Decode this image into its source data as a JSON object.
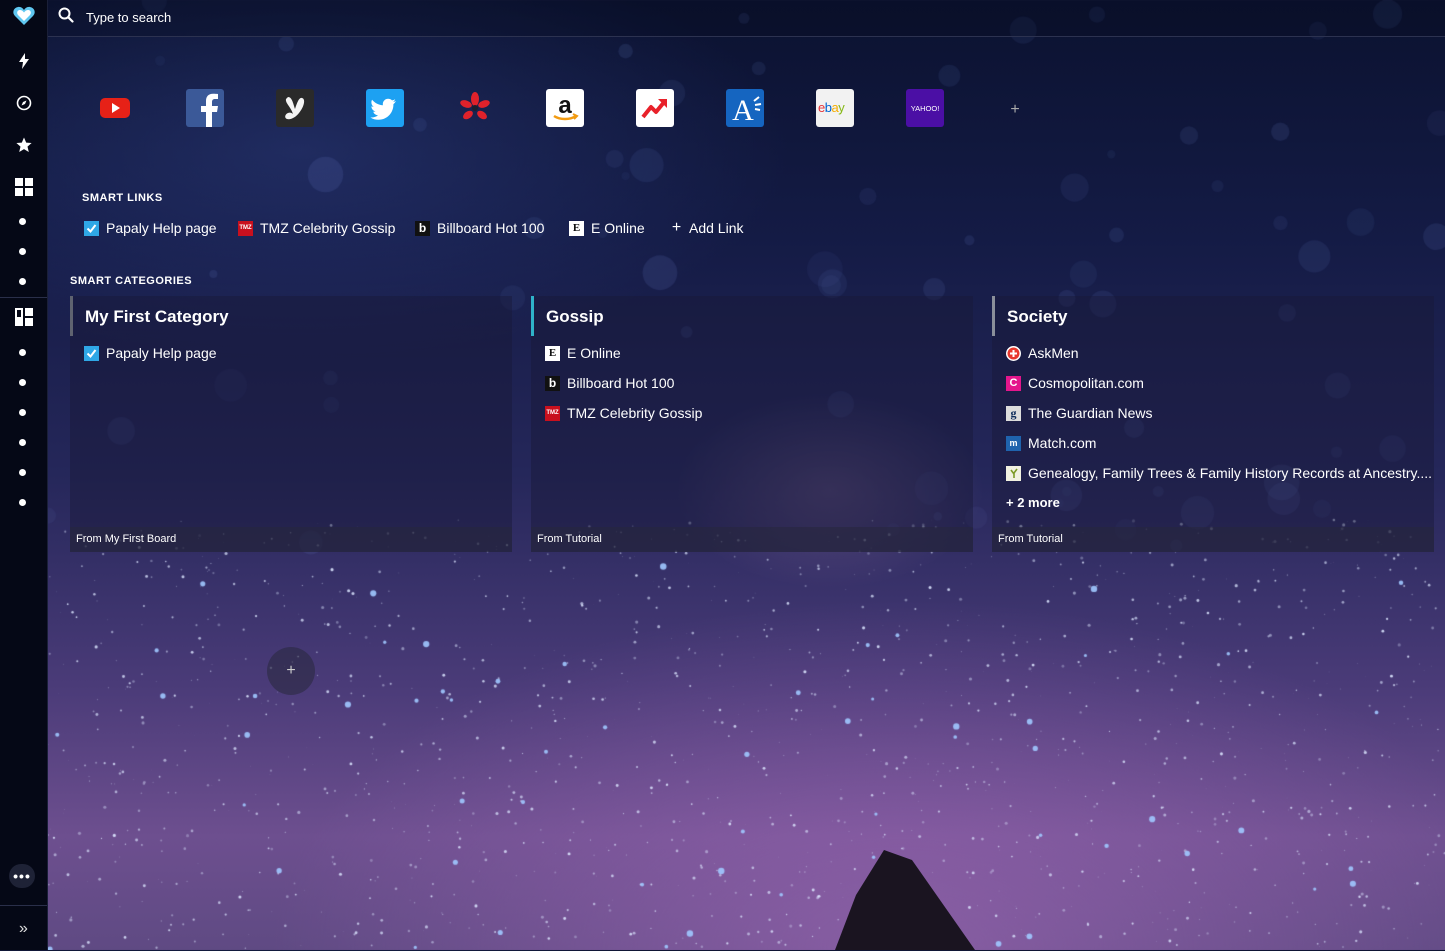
{
  "search": {
    "placeholder": "Type to search"
  },
  "sidebar": {
    "logo": "heart-icon",
    "items": [
      "bolt-icon",
      "compass-icon",
      "star-icon",
      "grid-icon",
      "boards-icon"
    ],
    "more_label": "•••",
    "expand_label": "»"
  },
  "tiles": [
    {
      "name": "YouTube",
      "icon": "youtube-icon",
      "color": "#1b1f2e"
    },
    {
      "name": "Facebook",
      "icon": "facebook-icon",
      "color": "#3b5998"
    },
    {
      "name": "Badoo",
      "icon": "badoo-icon",
      "color": "#2a2a2a"
    },
    {
      "name": "Twitter",
      "icon": "twitter-icon",
      "color": "#1da1f2"
    },
    {
      "name": "Yelp",
      "icon": "yelp-icon",
      "color": "#1b1f2e"
    },
    {
      "name": "Amazon",
      "icon": "amazon-icon",
      "color": "#ffffff"
    },
    {
      "name": "Trending",
      "icon": "trending-icon",
      "color": "#ffffff"
    },
    {
      "name": "Ask",
      "icon": "ask-icon",
      "color": "#1565c0"
    },
    {
      "name": "eBay",
      "icon": "ebay-icon",
      "color": "#f2f2f2",
      "label": "ebay"
    },
    {
      "name": "Yahoo",
      "icon": "yahoo-icon",
      "color": "#4b0fa5",
      "label": "YAHOO!"
    }
  ],
  "tile_add_label": "+",
  "smart_links": {
    "label": "SMART LINKS",
    "items": [
      {
        "label": "Papaly Help page",
        "icon": "papaly-icon"
      },
      {
        "label": "TMZ Celebrity Gossip",
        "icon": "tmz-icon"
      },
      {
        "label": "Billboard Hot 100",
        "icon": "billboard-icon"
      },
      {
        "label": "E Online",
        "icon": "eonline-icon"
      }
    ],
    "add_label": "Add Link"
  },
  "smart_categories": {
    "label": "SMART CATEGORIES",
    "cards": [
      {
        "title": "My First Category",
        "accent": "#5f6370",
        "items": [
          {
            "label": "Papaly Help page",
            "icon": "papaly-icon"
          }
        ],
        "footer": "From My First Board"
      },
      {
        "title": "Gossip",
        "accent": "#2fb3c9",
        "items": [
          {
            "label": "E Online",
            "icon": "eonline-icon"
          },
          {
            "label": "Billboard Hot 100",
            "icon": "billboard-icon"
          },
          {
            "label": "TMZ Celebrity Gossip",
            "icon": "tmz-icon"
          }
        ],
        "footer": "From Tutorial"
      },
      {
        "title": "Society",
        "accent": "#8a8f9a",
        "items": [
          {
            "label": "AskMen",
            "icon": "askmen-icon"
          },
          {
            "label": "Cosmopolitan.com",
            "icon": "cosmopolitan-icon"
          },
          {
            "label": "The Guardian News",
            "icon": "guardian-icon"
          },
          {
            "label": "Match.com",
            "icon": "match-icon"
          },
          {
            "label": "Genealogy, Family Trees & Family History Records at Ancestry....",
            "icon": "ancestry-icon"
          }
        ],
        "more_label": "+ 2 more",
        "footer": "From Tutorial"
      }
    ]
  },
  "add_category_label": "+"
}
